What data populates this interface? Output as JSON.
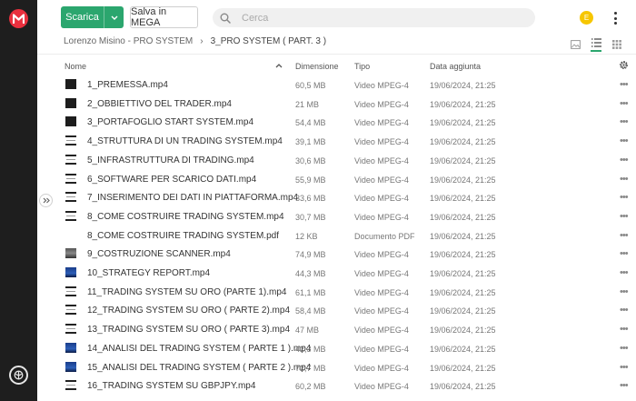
{
  "topbar": {
    "download_label": "Scarica",
    "save_label": "Salva in MEGA",
    "search_placeholder": "Cerca",
    "avatar_initial": "E",
    "colors": {
      "accent": "#2ba66e",
      "avatar": "#f6c600",
      "brand": "#e9303e"
    }
  },
  "breadcrumb": {
    "root": "Lorenzo Misino - PRO SYSTEM",
    "current": "3_PRO SYSTEM ( PART. 3 )"
  },
  "columns": {
    "name": "Nome",
    "size": "Dimensione",
    "type": "Tipo",
    "date": "Data aggiunta"
  },
  "files": [
    {
      "name": "1_PREMESSA.mp4",
      "size": "60,5 MB",
      "type": "Video MPEG-4",
      "date": "19/06/2024, 21:25",
      "thumb": "dark"
    },
    {
      "name": "2_OBBIETTIVO DEL TRADER.mp4",
      "size": "21 MB",
      "type": "Video MPEG-4",
      "date": "19/06/2024, 21:25",
      "thumb": "dark"
    },
    {
      "name": "3_PORTAFOGLIO START SYSTEM.mp4",
      "size": "54,4 MB",
      "type": "Video MPEG-4",
      "date": "19/06/2024, 21:25",
      "thumb": "dark"
    },
    {
      "name": "4_STRUTTURA DI UN TRADING SYSTEM.mp4",
      "size": "39,1 MB",
      "type": "Video MPEG-4",
      "date": "19/06/2024, 21:25",
      "thumb": "striped"
    },
    {
      "name": "5_INFRASTRUTTURA DI TRADING.mp4",
      "size": "30,6 MB",
      "type": "Video MPEG-4",
      "date": "19/06/2024, 21:25",
      "thumb": "striped"
    },
    {
      "name": "6_SOFTWARE PER SCARICO DATI.mp4",
      "size": "55,9 MB",
      "type": "Video MPEG-4",
      "date": "19/06/2024, 21:25",
      "thumb": "striped"
    },
    {
      "name": "7_INSERIMENTO DEI DATI IN PIATTAFORMA.mp4",
      "size": "33,6 MB",
      "type": "Video MPEG-4",
      "date": "19/06/2024, 21:25",
      "thumb": "striped"
    },
    {
      "name": "8_COME COSTRUIRE TRADING SYSTEM.mp4",
      "size": "30,7 MB",
      "type": "Video MPEG-4",
      "date": "19/06/2024, 21:25",
      "thumb": "striped"
    },
    {
      "name": "8_COME COSTRUIRE TRADING SYSTEM.pdf",
      "size": "12 KB",
      "type": "Documento PDF",
      "date": "19/06/2024, 21:25",
      "thumb": "pdf"
    },
    {
      "name": "9_COSTRUZIONE SCANNER.mp4",
      "size": "74,9 MB",
      "type": "Video MPEG-4",
      "date": "19/06/2024, 21:25",
      "thumb": "grey"
    },
    {
      "name": "10_STRATEGY REPORT.mp4",
      "size": "44,3 MB",
      "type": "Video MPEG-4",
      "date": "19/06/2024, 21:25",
      "thumb": "blue"
    },
    {
      "name": "11_TRADING SYSTEM SU ORO (PARTE 1).mp4",
      "size": "61,1 MB",
      "type": "Video MPEG-4",
      "date": "19/06/2024, 21:25",
      "thumb": "striped"
    },
    {
      "name": "12_TRADING SYSTEM SU ORO ( PARTE 2).mp4",
      "size": "58,4 MB",
      "type": "Video MPEG-4",
      "date": "19/06/2024, 21:25",
      "thumb": "striped"
    },
    {
      "name": "13_TRADING SYSTEM SU ORO ( PARTE 3).mp4",
      "size": "47 MB",
      "type": "Video MPEG-4",
      "date": "19/06/2024, 21:25",
      "thumb": "striped"
    },
    {
      "name": "14_ANALISI DEL TRADING SYSTEM ( PARTE 1 ).mp4",
      "size": "42,3 MB",
      "type": "Video MPEG-4",
      "date": "19/06/2024, 21:25",
      "thumb": "blue"
    },
    {
      "name": "15_ANALISI DEL TRADING SYSTEM ( PARTE 2 ).mp4",
      "size": "72,7 MB",
      "type": "Video MPEG-4",
      "date": "19/06/2024, 21:25",
      "thumb": "blue"
    },
    {
      "name": "16_TRADING SYSTEM SU GBPJPY.mp4",
      "size": "60,2 MB",
      "type": "Video MPEG-4",
      "date": "19/06/2024, 21:25",
      "thumb": "striped"
    }
  ]
}
